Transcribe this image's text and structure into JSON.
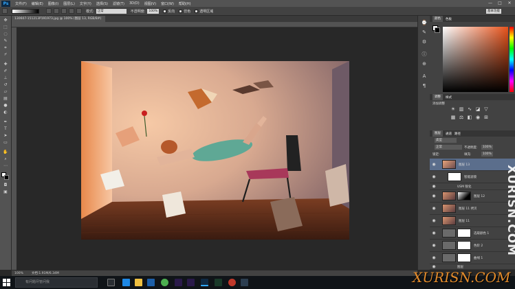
{
  "app": {
    "logo": "Ps"
  },
  "menu": [
    "文件(F)",
    "编辑(E)",
    "图像(I)",
    "图层(L)",
    "文字(Y)",
    "选择(S)",
    "滤镜(T)",
    "3D(D)",
    "视图(V)",
    "窗口(W)",
    "帮助(H)"
  ],
  "window_controls": [
    "—",
    "□",
    "✕"
  ],
  "options": {
    "mode_label": "模式:",
    "mode_value": "正常",
    "opacity_label": "不透明度:",
    "opacity_value": "100%",
    "reverse_label": "反向",
    "dither_label": "仿色",
    "transparency_label": "透明区域",
    "workspace": "基本功能"
  },
  "document_tab": {
    "title": "130607-151213P191973.jpg @ 100% (图层 13, RGB/8#)",
    "close": "×"
  },
  "status": {
    "zoom": "100%",
    "doc": "文档:1.91M/6.34M"
  },
  "panels": {
    "color_tabs": [
      "颜色",
      "色板"
    ],
    "adjust_tabs": [
      "调整",
      "样式"
    ],
    "adjust_title": "添加调整",
    "layers_tabs": [
      "图层",
      "通道",
      "路径"
    ],
    "kind_label": "类型",
    "blend": "正常",
    "opacity_label": "不透明度:",
    "opacity_value": "100%",
    "lock_label": "锁定:",
    "fill_label": "填充:",
    "fill_value": "100%"
  },
  "layers": [
    {
      "name": "图层 13",
      "selected": true
    },
    {
      "name": "智能滤镜",
      "selected": false
    },
    {
      "name": "USM 锐化",
      "selected": false
    },
    {
      "name": "图层 12",
      "selected": false
    },
    {
      "name": "图层 11 拷贝",
      "selected": false
    },
    {
      "name": "图层 11",
      "selected": false
    },
    {
      "name": "选取颜色 1",
      "selected": false
    },
    {
      "name": "色阶 2",
      "selected": false
    },
    {
      "name": "曲线 1",
      "selected": false
    },
    {
      "name": "图层",
      "selected": false
    }
  ],
  "taskbar": {
    "search_placeholder": "有问题尽管问我"
  },
  "watermark": {
    "main": "XURISN.COM",
    "vertical": "XURISN.COM"
  }
}
